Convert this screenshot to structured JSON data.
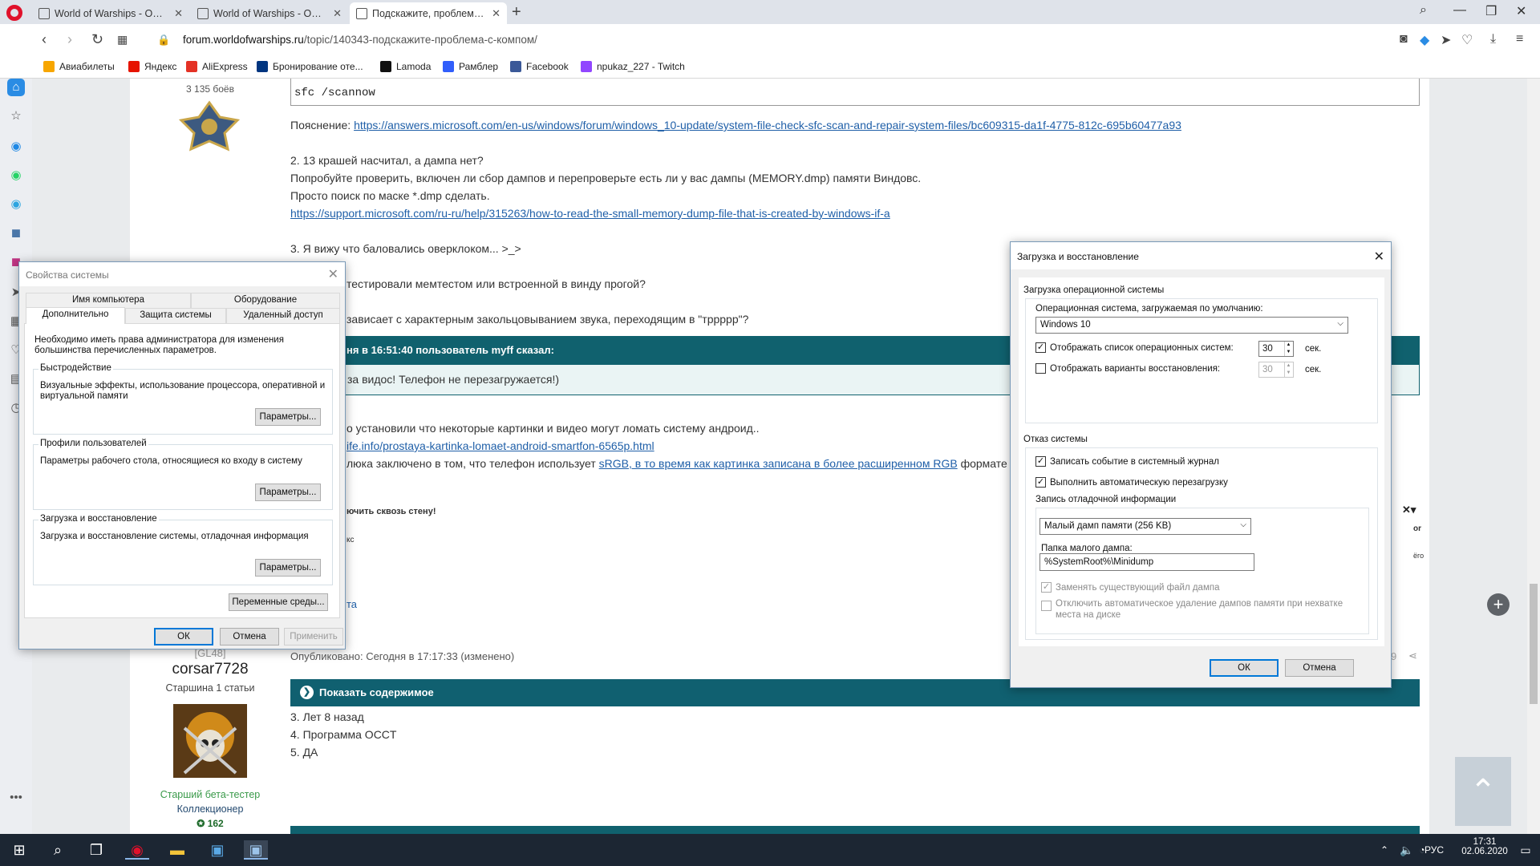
{
  "browser": {
    "tabs": [
      {
        "title": "World of Warships - Офиц",
        "active": false
      },
      {
        "title": "World of Warships - Офиц",
        "active": false
      },
      {
        "title": "Подскажите, проблема с к",
        "active": true
      }
    ],
    "url_host": "forum.worldofwarships.ru",
    "url_path": "/topic/140343-подскажите-проблема-с-компом/",
    "bookmarks": [
      {
        "label": "Авиабилеты",
        "color": "#f7a600"
      },
      {
        "label": "Яндекс",
        "color": "#e61400"
      },
      {
        "label": "AliExpress",
        "color": "#e43225"
      },
      {
        "label": "Бронирование оте...",
        "color": "#003580"
      },
      {
        "label": "Lamoda",
        "color": "#111111"
      },
      {
        "label": "Рамблер",
        "color": "#315efb"
      },
      {
        "label": "Facebook",
        "color": "#3b5998"
      },
      {
        "label": "npukaz_227 - Twitch",
        "color": "#9146ff"
      }
    ]
  },
  "forum": {
    "user1_battles": "3 135 боёв",
    "code": "sfc /scannow",
    "explain_label": "Пояснение:",
    "explain_link": "https://answers.microsoft.com/en-us/windows/forum/windows_10-update/system-file-check-sfc-scan-and-repair-system-files/bc609315-da1f-4775-812c-695b60477a93",
    "p2_line1": "2. 13 крашей насчитал, а дампа нет?",
    "p2_line2": "Попробуйте проверить, включен ли сбор дампов и перепроверьте есть ли у вас дампы (MEMORY.dmp) памяти Виндовс.",
    "p2_line3": "Просто поиск по маске *.dmp сделать.",
    "p2_link": "https://support.microsoft.com/ru-ru/help/315263/how-to-read-the-small-memory-dump-file-that-is-created-by-windows-if-a",
    "p3": "3. Я вижу что баловались оверклоком... >_>",
    "p4": "тестировали мемтестом или встроенной в винду прогой?",
    "p5": "зависает с характерным закольцовыванием звука, переходящим в \"трpppp\"?",
    "quote_head": "ня в 16:51:40 пользователь myff сказал:",
    "quote_body": "за видос! Телефон не перезагружается!)",
    "p6": "о установили что некоторые картинки и видео могут ломать систему андроид..",
    "p6_link": "ife.info/prostaya-kartinka-lomaet-android-smartfon-6565p.html",
    "p7_pre": "люка заключено в том, что телефон использует ",
    "p7_link": "sRGB, в то время как картинка записана в более расширенном RGB",
    "p7_post": " формате",
    "sig_text": "ючить сквозь стену!",
    "sig_small": "кс",
    "sig_link": "та",
    "ad_right1": "or",
    "ad_right2": "ёго",
    "clan_tag": "[GL48]",
    "user2_name": "corsar7728",
    "user2_rank": "Старшина 1 статьи",
    "user2_title": "Старший бета-тестер",
    "user2_badge": "Коллекционер",
    "user2_points": "162",
    "published": "Опубликовано: Сегодня в 17:17:33 (изменено)",
    "published_right": "9",
    "show_content": "Показать содержимое",
    "ans3": "3. Лет 8 назад",
    "ans4": "4. Программа OCCT",
    "ans5": "5. ДА"
  },
  "sysprops": {
    "title": "Свойства системы",
    "tabs_row1": [
      "Имя компьютера",
      "Оборудование"
    ],
    "tabs_row2": [
      "Дополнительно",
      "Защита системы",
      "Удаленный доступ"
    ],
    "admin_note": "Необходимо иметь права администратора для изменения большинства перечисленных параметров.",
    "perf_label": "Быстродействие",
    "perf_desc": "Визуальные эффекты, использование процессора, оперативной и виртуальной памяти",
    "profiles_label": "Профили пользователей",
    "profiles_desc": "Параметры рабочего стола, относящиеся ко входу в систему",
    "startup_label": "Загрузка и восстановление",
    "startup_desc": "Загрузка и восстановление системы, отладочная информация",
    "params_btn": "Параметры...",
    "env_btn": "Переменные среды...",
    "ok": "ОК",
    "cancel": "Отмена",
    "apply": "Применить"
  },
  "startup": {
    "title": "Загрузка и восстановление",
    "os_group": "Загрузка операционной системы",
    "default_os_label": "Операционная система, загружаемая по умолчанию:",
    "default_os": "Windows 10",
    "show_list": "Отображать список операционных систем:",
    "show_list_value": "30",
    "show_recovery": "Отображать варианты восстановления:",
    "show_recovery_value": "30",
    "sec": "сек.",
    "failure_group": "Отказ системы",
    "write_event": "Записать событие в системный журнал",
    "auto_restart": "Выполнить автоматическую перезагрузку",
    "debug_group": "Запись отладочной информации",
    "dump_type": "Малый дамп памяти (256 KB)",
    "dump_folder_label": "Папка малого дампа:",
    "dump_folder": "%SystemRoot%\\Minidump",
    "overwrite": "Заменять существующий файл дампа",
    "disable_auto_delete": "Отключить автоматическое удаление дампов памяти при нехватке места на диске",
    "ok": "ОК",
    "cancel": "Отмена"
  },
  "taskbar": {
    "lang": "РУС",
    "time": "17:31",
    "date": "02.06.2020"
  }
}
